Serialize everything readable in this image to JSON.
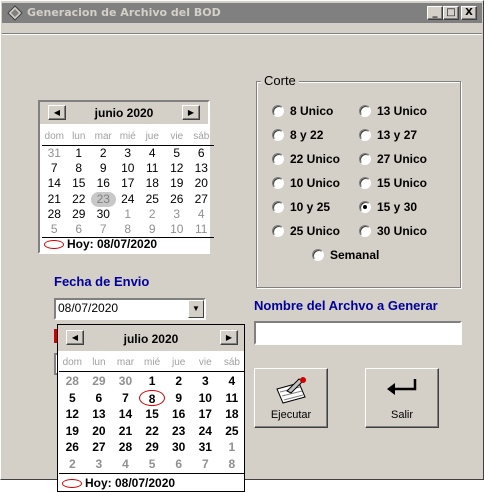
{
  "window": {
    "title": "Generacion de Archivo del BOD"
  },
  "titlebar": {
    "minimize": "_",
    "maximize": "□",
    "close": "X"
  },
  "calendar_main": {
    "month": "junio 2020",
    "weekdays": [
      "dom",
      "lun",
      "mar",
      "mié",
      "jue",
      "vie",
      "sáb"
    ],
    "weeks": [
      [
        "31",
        "1",
        "2",
        "3",
        "4",
        "5",
        "6"
      ],
      [
        "7",
        "8",
        "9",
        "10",
        "11",
        "12",
        "13"
      ],
      [
        "14",
        "15",
        "16",
        "17",
        "18",
        "19",
        "20"
      ],
      [
        "21",
        "22",
        "23",
        "24",
        "25",
        "26",
        "27"
      ],
      [
        "28",
        "29",
        "30",
        "1",
        "2",
        "3",
        "4"
      ],
      [
        "5",
        "6",
        "7",
        "8",
        "9",
        "10",
        "11"
      ]
    ],
    "today_label": "Hoy: 08/07/2020"
  },
  "fecha_envio": {
    "label": "Fecha de Envio",
    "value": "08/07/2020"
  },
  "corte": {
    "title": "Corte",
    "options": [
      {
        "label": "8 Unico",
        "checked": false
      },
      {
        "label": "13 Unico",
        "checked": false
      },
      {
        "label": "8 y 22",
        "checked": false
      },
      {
        "label": "13 y 27",
        "checked": false
      },
      {
        "label": "22 Unico",
        "checked": false
      },
      {
        "label": "27 Unico",
        "checked": false
      },
      {
        "label": "10 Unico",
        "checked": false
      },
      {
        "label": "15 Unico",
        "checked": false
      },
      {
        "label": "10 y 25",
        "checked": false
      },
      {
        "label": "15 y 30",
        "checked": true
      },
      {
        "label": "25 Unico",
        "checked": false
      },
      {
        "label": "30 Unico",
        "checked": false
      },
      {
        "label": "Semanal",
        "checked": false
      }
    ]
  },
  "nombre_archivo": {
    "label": "Nombre del Archvo a Generar",
    "value": ""
  },
  "buttons": {
    "ejecutar": "Ejecutar",
    "salir": "Salir"
  },
  "calendar_popup": {
    "month": "julio 2020",
    "weekdays": [
      "dom",
      "lun",
      "mar",
      "mié",
      "jue",
      "vie",
      "sáb"
    ],
    "weeks": [
      [
        "28",
        "29",
        "30",
        "1",
        "2",
        "3",
        "4"
      ],
      [
        "5",
        "6",
        "7",
        "8",
        "9",
        "10",
        "11"
      ],
      [
        "12",
        "13",
        "14",
        "15",
        "16",
        "17",
        "18"
      ],
      [
        "19",
        "20",
        "21",
        "22",
        "23",
        "24",
        "25"
      ],
      [
        "26",
        "27",
        "28",
        "29",
        "30",
        "31",
        "1"
      ],
      [
        "2",
        "3",
        "4",
        "5",
        "6",
        "7",
        "8"
      ]
    ],
    "today_label": "Hoy: 08/07/2020"
  },
  "colors": {
    "label_blue": "#00009a",
    "today_ring": "#d00000",
    "face": "#d4d0c8"
  }
}
